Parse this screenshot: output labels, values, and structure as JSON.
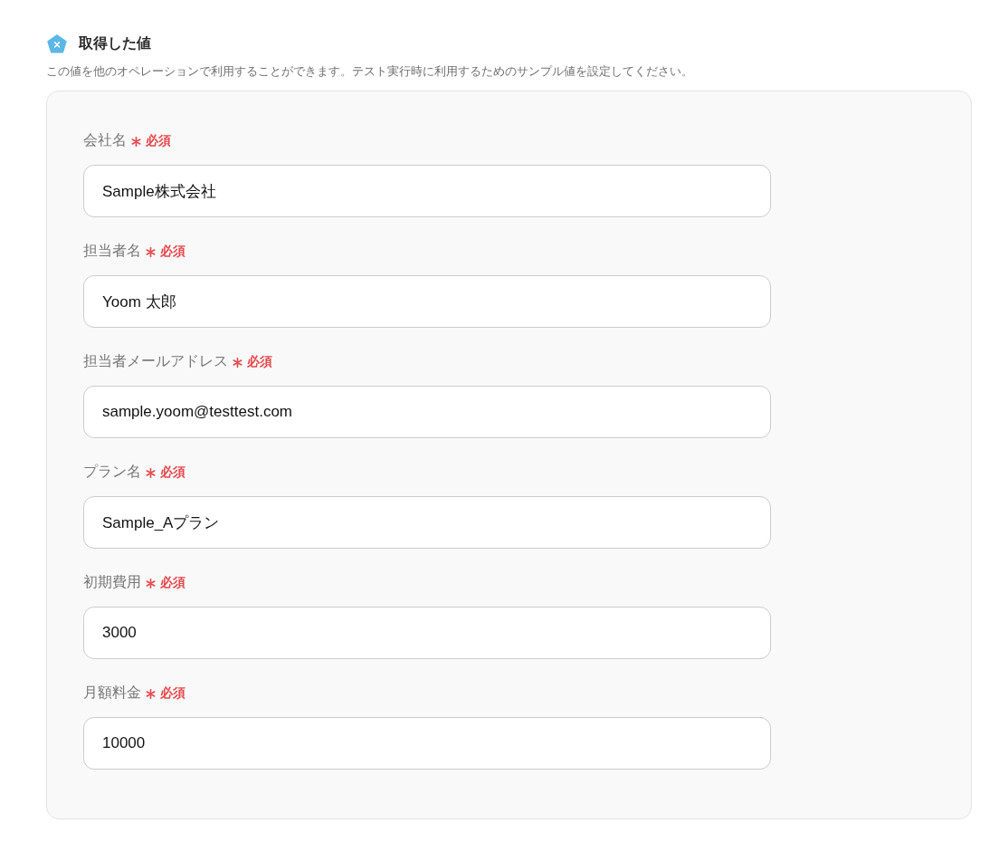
{
  "section": {
    "title": "取得した値",
    "description": "この値を他のオペレーションで利用することができます。テスト実行時に利用するためのサンプル値を設定してください。"
  },
  "fields": [
    {
      "label": "会社名",
      "required_text": "必須",
      "value": "Sample株式会社"
    },
    {
      "label": "担当者名",
      "required_text": "必須",
      "value": "Yoom 太郎"
    },
    {
      "label": "担当者メールアドレス",
      "required_text": "必須",
      "value": "sample.yoom@testtest.com"
    },
    {
      "label": "プラン名",
      "required_text": "必須",
      "value": "Sample_Aプラン"
    },
    {
      "label": "初期費用",
      "required_text": "必須",
      "value": "3000"
    },
    {
      "label": "月額料金",
      "required_text": "必須",
      "value": "10000"
    }
  ]
}
